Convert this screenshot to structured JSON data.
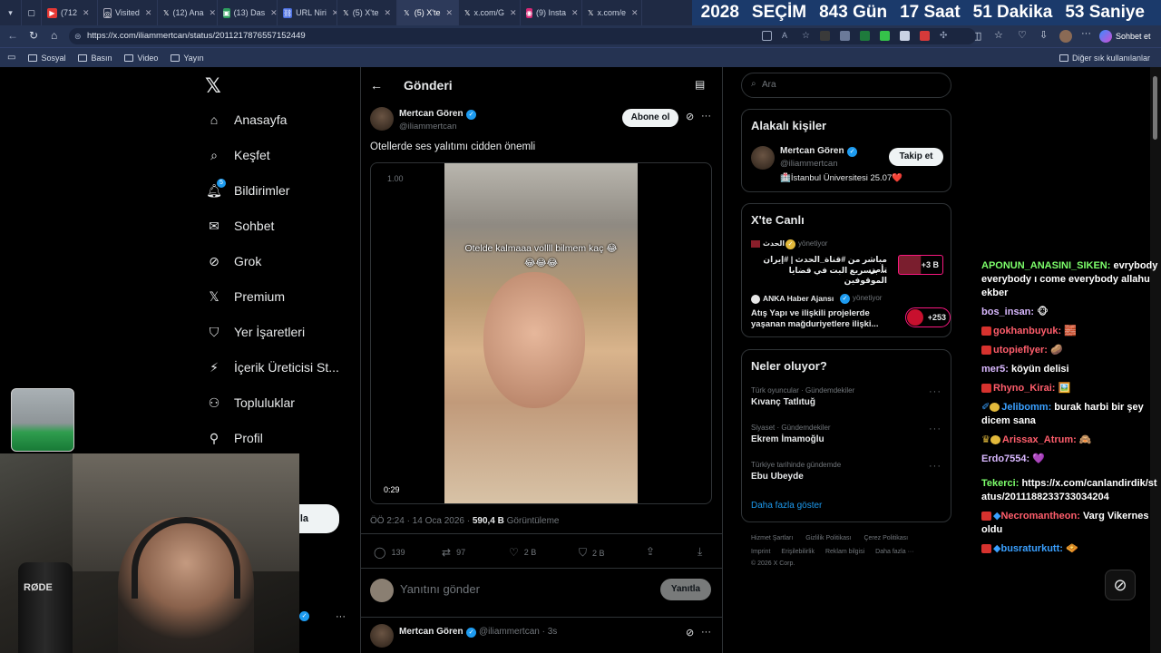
{
  "browser": {
    "tabs": [
      {
        "label": "(712",
        "color": "#e53935"
      },
      {
        "label": "Visited",
        "color": "#7d8597"
      },
      {
        "label": "(12) Ana",
        "color": "#000000"
      },
      {
        "label": "(13) Das",
        "color": "#2e9e5e"
      },
      {
        "label": "URL Niri",
        "color": "#4a6ee0"
      },
      {
        "label": "(5) X'te",
        "color": "#000000"
      },
      {
        "label": "(5) X'te",
        "color": "#000000"
      },
      {
        "label": "x.com/G",
        "color": "#000000"
      },
      {
        "label": "(9) Insta",
        "color": "#d62976"
      },
      {
        "label": "x.com/e",
        "color": "#000000"
      }
    ],
    "countdown": {
      "year": "2028",
      "election": "SEÇİM",
      "days": "843 Gün",
      "hours": "17 Saat",
      "minutes": "51 Dakika",
      "seconds": "53 Saniye"
    },
    "url": "https://x.com/iliammertcan/status/2011217876557152449",
    "chat_button": "Sohbet et",
    "bookmarks": [
      "Sosyal",
      "Basın",
      "Video",
      "Yayın"
    ],
    "other_bookmarks": "Diğer sık kullanılanlar"
  },
  "nav": {
    "items": [
      "Anasayfa",
      "Keşfet",
      "Bildirimler",
      "Sohbet",
      "Grok",
      "Premium",
      "Yer İşaretleri",
      "İçerik Üreticisi St...",
      "Topluluklar",
      "Profil"
    ],
    "notif_count": "5",
    "post_button_partial": "la"
  },
  "post": {
    "header_title": "Gönderi",
    "author_name": "Mertcan Gören",
    "author_handle": "@iliammertcan",
    "follow_label": "Abone ol",
    "text": "Otellerde ses yalıtımı cidden önemli",
    "video_caption_line1": "Otelde kalmaaa vollll bilmem kaç 😂",
    "video_caption_line2": "😂😂😂",
    "video_speed": "1.00",
    "video_time": "0:29",
    "timestamp": "ÖÖ 2:24 · 14 Oca 2026 ·",
    "views_count": "590,4 B",
    "views_label": "Görüntüleme",
    "replies": "139",
    "reposts": "97",
    "likes": "2 B",
    "bookmarks": "2 B",
    "reply_placeholder": "Yanıtını gönder",
    "reply_button": "Yanıtla",
    "next_author": "Mertcan Gören",
    "next_handle": "@iliammertcan · 3s"
  },
  "sidebar": {
    "search_placeholder": "Ara",
    "related_title": "Alakalı kişiler",
    "related_name": "Mertcan Gören",
    "related_handle": "@iliammertcan",
    "related_bio": "🏥İstanbul Üniversitesi 25.07❤️",
    "related_follow": "Takip et",
    "live_title": "X'te Canlı",
    "live1_source": "الحدث",
    "live1_status": "yönetiyor",
    "live1_text_line1": "مباشر من #قناة_الحدث | #إيران تأمر",
    "live1_text_line2": "... بتسريع البت في قضايا الموقوفين",
    "live1_count": "+3 B",
    "live2_source": "ANKA Haber Ajansı",
    "live2_status": "yönetiyor",
    "live2_text_line1": "Atış Yapı ve ilişkili projelerde",
    "live2_text_line2": "yaşanan mağduriyetlere ilişki...",
    "live2_count": "+253",
    "trends_title": "Neler oluyor?",
    "trends": [
      {
        "context": "Türk oyuncular · Gündemdekiler",
        "name": "Kıvanç Tatlıtuğ"
      },
      {
        "context": "Siyaset · Gündemdekiler",
        "name": "Ekrem İmamoğlu"
      },
      {
        "context": "Türkiye tarihinde gündemde",
        "name": "Ebu Ubeyde"
      }
    ],
    "show_more": "Daha fazla göster",
    "footer_row1": [
      "Hizmet Şartları",
      "Gizlilik Politikası",
      "Çerez Politikası"
    ],
    "footer_row2": [
      "Imprint",
      "Erişilebilirlik",
      "Reklam bilgisi",
      "Daha fazla ···"
    ],
    "copyright": "© 2026 X Corp."
  },
  "chat": [
    {
      "user": "APONUN_ANASINI_SIKEN:",
      "color": "#7dff6b",
      "text": "evrybody everybody ı come everybody allahu ekber"
    },
    {
      "user": "bos_insan:",
      "color": "#d9b8ff",
      "text": "🐵"
    },
    {
      "user": "gokhanbuyuk:",
      "color": "#ff5e6c",
      "text": "🧱"
    },
    {
      "user": "utopieflyer:",
      "color": "#ff5e6c",
      "text": "🥔"
    },
    {
      "user": "mer5:",
      "color": "#d9b8ff",
      "text": "köyün delisi"
    },
    {
      "user": "Rhyno_Kirai:",
      "color": "#ff5e6c",
      "text": "🖼️"
    },
    {
      "user": "Jelibomm:",
      "color": "#3aa0ff",
      "text": "burak harbi bir şey dicem sana"
    },
    {
      "user": "Arissax_Atrum:",
      "color": "#ff5e6c",
      "text": "🙈"
    },
    {
      "user": "Erdo7554:",
      "color": "#d9b8ff",
      "text": "💜"
    },
    {
      "user": "Tekerci:",
      "color": "#7dff6b",
      "text": "https://x.com/canlandirdik/status/2011188233733034204"
    },
    {
      "user": "Necromantheon:",
      "color": "#ff5e6c",
      "text": "Varg Vikernes oldu"
    },
    {
      "user": "busraturkutt:",
      "color": "#3aa0ff",
      "text": "🧇"
    }
  ],
  "webcam": {
    "mic_brand": "RØDE"
  },
  "colors": {
    "accent": "#1d9bf0",
    "bg": "#000000",
    "border": "#2f3336",
    "countdown_bg": "#1b3a6b"
  }
}
